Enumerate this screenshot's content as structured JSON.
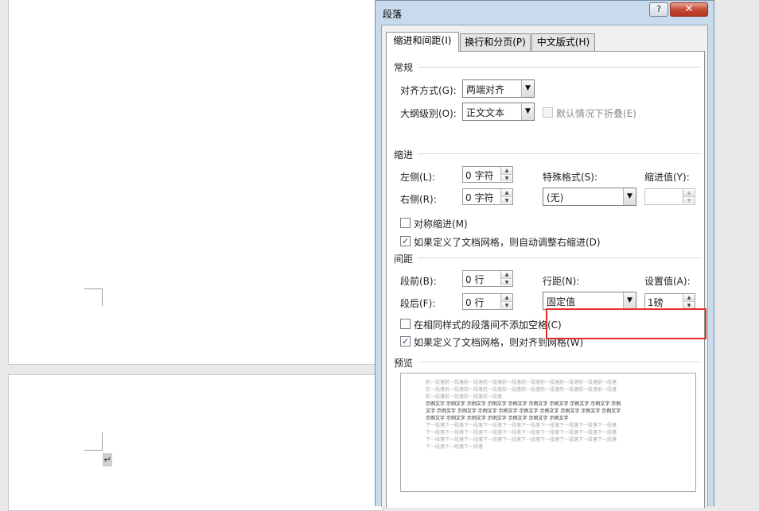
{
  "document": {
    "paragraph_mark": "↵"
  },
  "dialog": {
    "title": "段落",
    "help_label": "?",
    "close_label": "✕",
    "tabs": [
      {
        "label": "缩进和间距(I)",
        "active": true
      },
      {
        "label": "换行和分页(P)",
        "active": false
      },
      {
        "label": "中文版式(H)",
        "active": false
      }
    ],
    "general": {
      "section_label": "常规",
      "alignment_label": "对齐方式(G):",
      "alignment_value": "两端对齐",
      "outline_label": "大纲级别(O):",
      "outline_value": "正文文本",
      "collapse_label": "默认情况下折叠(E)",
      "collapse_checked": false
    },
    "indent": {
      "section_label": "缩进",
      "left_label": "左侧(L):",
      "left_value": "0 字符",
      "right_label": "右侧(R):",
      "right_value": "0 字符",
      "special_label": "特殊格式(S):",
      "special_value": "(无)",
      "by_label": "缩进值(Y):",
      "by_value": "",
      "mirror_label": "对称缩进(M)",
      "mirror_checked": false,
      "auto_adjust_label": "如果定义了文档网格，则自动调整右缩进(D)",
      "auto_adjust_checked": true
    },
    "spacing": {
      "section_label": "间距",
      "before_label": "段前(B):",
      "before_value": "0 行",
      "after_label": "段后(F):",
      "after_value": "0 行",
      "line_spacing_label": "行距(N):",
      "line_spacing_value": "固定值",
      "at_label": "设置值(A):",
      "at_value": "1磅",
      "no_space_label": "在相同样式的段落间不添加空格(C)",
      "no_space_checked": false,
      "snap_grid_label": "如果定义了文档网格，则对齐到网格(W)",
      "snap_grid_checked": true
    },
    "preview": {
      "section_label": "预览",
      "prev_lines": [
        "前一段落前一段落前一段落前一段落前一段落前一段落前一段落前一段落前一段落前一段落",
        "前一段落前一段落前一段落前一段落前一段落前一段落前一段落前一段落前一段落前一段落",
        "前一段落前一段落前一段落前一段落"
      ],
      "sample_lines": [
        "示例文字 示例文字 示例文字 示例文字 示例文字 示例文字 示例文字 示例文字 示例文字 示例",
        "文字 示例文字 示例文字 示例文字 示例文字 示例文字 示例文字 示例文字 示例文字 示例文字",
        "示例文字 示例文字 示例文字 示例文字 示例文字 示例文字 示例文字"
      ],
      "next_lines": [
        "下一段落下一段落下一段落下一段落下一段落下一段落下一段落下一段落下一段落下一段落",
        "下一段落下一段落下一段落下一段落下一段落下一段落下一段落下一段落下一段落下一段落",
        "下一段落下一段落下一段落下一段落下一段落下一段落下一段落下一段落下一段落下一段落",
        "下一段落下一段落下一段落"
      ]
    },
    "colors": {
      "highlight_border": "#e32c2c",
      "title_frame": "#c8dbed",
      "close_button": "#c74a33"
    }
  }
}
